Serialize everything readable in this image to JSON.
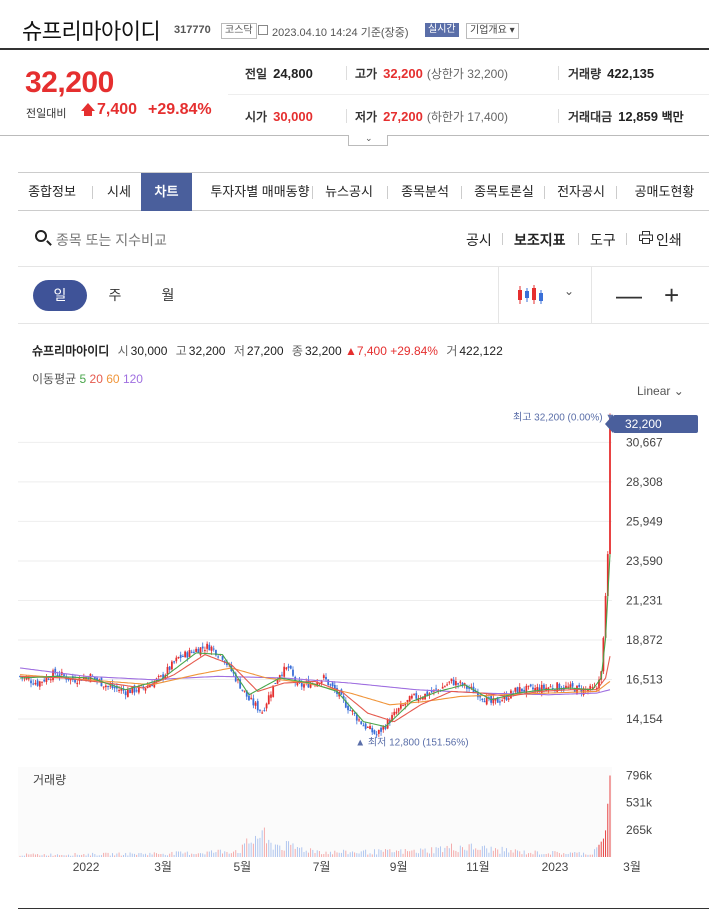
{
  "header": {
    "name": "슈프리마아이디",
    "code": "317770",
    "market": "코스닥",
    "datetime": "2023.04.10 14:24 기준(장중)",
    "realtime": "실시간",
    "company_info": "기업개요 ▾"
  },
  "price": {
    "current": "32,200",
    "compare_label": "전일대비",
    "change": "7,400",
    "change_pct": "+29.84%"
  },
  "info": {
    "prev_label": "전일",
    "prev": "24,800",
    "high_label": "고가",
    "high": "32,200",
    "high_sub": "(상한가 32,200)",
    "volume_label": "거래량",
    "volume": "422,135",
    "open_label": "시가",
    "open": "30,000",
    "low_label": "저가",
    "low": "27,200",
    "low_sub": "(하한가 17,400)",
    "amount_label": "거래대금",
    "amount": "12,859",
    "amount_unit": "백만"
  },
  "tabs": [
    "종합정보",
    "시세",
    "차트",
    "투자자별 매매동향",
    "뉴스공시",
    "종목분석",
    "종목토론실",
    "전자공시",
    "공매도현황"
  ],
  "toolbar": {
    "search_placeholder": "종목 또는 지수비교",
    "disclosure": "공시",
    "indicators": "보조지표",
    "tools": "도구",
    "print": "인쇄"
  },
  "periods": [
    "일",
    "주",
    "월"
  ],
  "zoom": {
    "out": "—",
    "in": "+"
  },
  "chart_info": {
    "name": "슈프리마아이디",
    "open_k": "시",
    "open": "30,000",
    "high_k": "고",
    "high": "32,200",
    "low_k": "저",
    "low": "27,200",
    "close_k": "종",
    "close": "32,200",
    "change": "▲7,400",
    "pct": "+29.84%",
    "vol_k": "거",
    "vol": "422,122"
  },
  "ma_legend": {
    "label": "이동평균",
    "m5": "5",
    "m20": "20",
    "m60": "60",
    "m120": "120"
  },
  "scale_mode": "Linear",
  "colors": {
    "up": "#e52f2f",
    "down": "#3a6fd8",
    "accent": "#4a5f9c",
    "ma5": "#48a54b",
    "ma20": "#e55a4e",
    "ma60": "#f0953a",
    "ma120": "#9f6fe0"
  },
  "chart_data": {
    "type": "candlestick",
    "y_ticks": [
      "30,667",
      "28,308",
      "25,949",
      "23,590",
      "21,231",
      "18,872",
      "16,513",
      "14,154"
    ],
    "y_tick_values": [
      30667,
      28308,
      25949,
      23590,
      21231,
      18872,
      16513,
      14154
    ],
    "ylim": [
      12600,
      33200
    ],
    "x_ticks": [
      "2022",
      "3월",
      "5월",
      "7월",
      "9월",
      "11월",
      "2023",
      "3월"
    ],
    "last_price": "32,200",
    "high_marker": "최고 32,200 (0.00%)",
    "low_marker": "최저 12,800 (151.56%)",
    "volume_label": "거래량",
    "volume_ticks": [
      "796k",
      "531k",
      "265k"
    ],
    "volume_tick_values": [
      796000,
      531000,
      265000
    ],
    "close_trend": [
      [
        0,
        16700
      ],
      [
        8,
        16300
      ],
      [
        16,
        16900
      ],
      [
        24,
        16500
      ],
      [
        32,
        16700
      ],
      [
        40,
        16100
      ],
      [
        48,
        15800
      ],
      [
        56,
        16000
      ],
      [
        64,
        16600
      ],
      [
        72,
        17800
      ],
      [
        80,
        18300
      ],
      [
        86,
        18500
      ],
      [
        92,
        17900
      ],
      [
        98,
        16600
      ],
      [
        104,
        15300
      ],
      [
        110,
        14600
      ],
      [
        114,
        15800
      ],
      [
        118,
        16900
      ],
      [
        122,
        17200
      ],
      [
        126,
        16100
      ],
      [
        132,
        16300
      ],
      [
        138,
        16600
      ],
      [
        144,
        15700
      ],
      [
        150,
        14700
      ],
      [
        156,
        13800
      ],
      [
        162,
        13200
      ],
      [
        166,
        13800
      ],
      [
        172,
        14700
      ],
      [
        178,
        15400
      ],
      [
        184,
        15600
      ],
      [
        190,
        15900
      ],
      [
        196,
        16400
      ],
      [
        202,
        16100
      ],
      [
        208,
        15700
      ],
      [
        214,
        15100
      ],
      [
        220,
        15400
      ],
      [
        226,
        15900
      ],
      [
        232,
        15900
      ],
      [
        238,
        16000
      ],
      [
        244,
        16100
      ],
      [
        250,
        16000
      ],
      [
        256,
        15900
      ],
      [
        260,
        15900
      ],
      [
        262,
        16000
      ],
      [
        264,
        17000
      ],
      [
        265,
        19000
      ],
      [
        266,
        21500
      ],
      [
        267,
        24000
      ],
      [
        268,
        32200
      ]
    ],
    "ma5": [
      [
        0,
        16600
      ],
      [
        16,
        16700
      ],
      [
        32,
        16600
      ],
      [
        48,
        15900
      ],
      [
        64,
        16500
      ],
      [
        80,
        18100
      ],
      [
        92,
        18000
      ],
      [
        104,
        15600
      ],
      [
        118,
        16600
      ],
      [
        132,
        16300
      ],
      [
        144,
        15800
      ],
      [
        156,
        14000
      ],
      [
        166,
        13700
      ],
      [
        178,
        15200
      ],
      [
        190,
        15800
      ],
      [
        202,
        16200
      ],
      [
        214,
        15300
      ],
      [
        226,
        15700
      ],
      [
        238,
        15900
      ],
      [
        250,
        16000
      ],
      [
        260,
        15900
      ],
      [
        264,
        16600
      ],
      [
        266,
        19000
      ],
      [
        268,
        24000
      ]
    ],
    "ma20": [
      [
        0,
        16700
      ],
      [
        20,
        16600
      ],
      [
        40,
        16300
      ],
      [
        56,
        16000
      ],
      [
        70,
        16800
      ],
      [
        84,
        18000
      ],
      [
        96,
        17400
      ],
      [
        108,
        15800
      ],
      [
        120,
        16300
      ],
      [
        134,
        16400
      ],
      [
        146,
        15800
      ],
      [
        158,
        14500
      ],
      [
        170,
        14000
      ],
      [
        182,
        15000
      ],
      [
        196,
        15800
      ],
      [
        210,
        15700
      ],
      [
        222,
        15500
      ],
      [
        236,
        15800
      ],
      [
        250,
        15900
      ],
      [
        262,
        15900
      ],
      [
        266,
        16600
      ],
      [
        268,
        17900
      ]
    ],
    "ma60": [
      [
        0,
        16800
      ],
      [
        30,
        16500
      ],
      [
        60,
        16200
      ],
      [
        80,
        16800
      ],
      [
        96,
        17200
      ],
      [
        112,
        16600
      ],
      [
        130,
        16300
      ],
      [
        150,
        15700
      ],
      [
        168,
        15000
      ],
      [
        184,
        15200
      ],
      [
        200,
        15500
      ],
      [
        220,
        15600
      ],
      [
        240,
        15700
      ],
      [
        262,
        15800
      ],
      [
        268,
        16400
      ]
    ],
    "ma120": [
      [
        0,
        17200
      ],
      [
        30,
        16700
      ],
      [
        60,
        16500
      ],
      [
        90,
        16700
      ],
      [
        120,
        16600
      ],
      [
        150,
        16300
      ],
      [
        180,
        15900
      ],
      [
        210,
        15700
      ],
      [
        240,
        15600
      ],
      [
        262,
        15700
      ],
      [
        268,
        15900
      ]
    ],
    "volume_trend": [
      [
        0,
        20000
      ],
      [
        40,
        25000
      ],
      [
        80,
        35000
      ],
      [
        100,
        60000
      ],
      [
        110,
        220000
      ],
      [
        112,
        120000
      ],
      [
        140,
        40000
      ],
      [
        180,
        50000
      ],
      [
        200,
        90000
      ],
      [
        230,
        40000
      ],
      [
        260,
        30000
      ],
      [
        265,
        180000
      ],
      [
        266,
        260000
      ],
      [
        267,
        520000
      ],
      [
        268,
        796000
      ]
    ]
  }
}
